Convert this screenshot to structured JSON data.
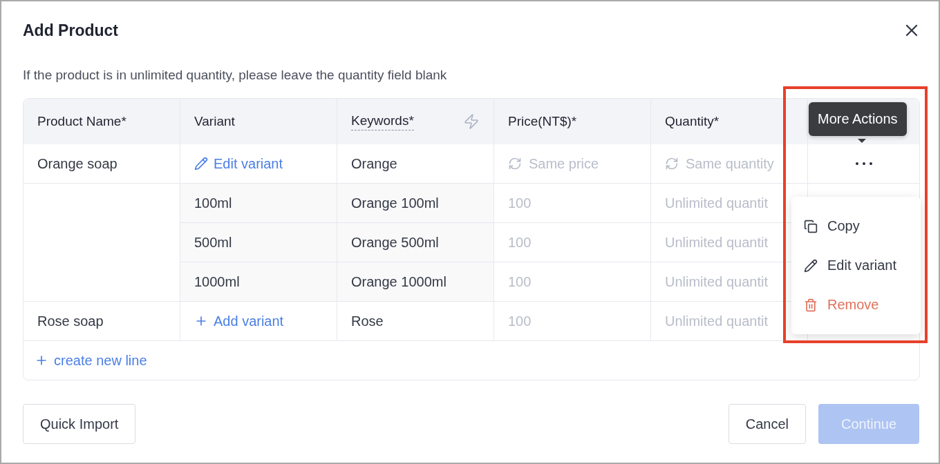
{
  "dialog": {
    "title": "Add Product",
    "notice": "If the product is in unlimited quantity, please leave the quantity field blank",
    "columns": [
      {
        "label": "Product Name*",
        "kind": "text"
      },
      {
        "label": "Variant",
        "kind": "text"
      },
      {
        "label": "Keywords*",
        "kind": "keywords"
      },
      {
        "label": "Price(NT$)*",
        "kind": "text"
      },
      {
        "label": "Quantity*",
        "kind": "text"
      }
    ],
    "products": [
      {
        "name": "Orange soap",
        "variant_action": {
          "kind": "edit",
          "label": "Edit variant"
        },
        "keywords": "Orange",
        "price": {
          "placeholder": "Same price",
          "kind": "sync-price"
        },
        "quantity": {
          "placeholder": "Same quantity",
          "kind": "sync-quantity"
        },
        "more_button": true,
        "variants": [
          {
            "name": "100ml",
            "keywords": "Orange 100ml",
            "price": {
              "placeholder": "100"
            },
            "quantity": {
              "placeholder": "Unlimited quantit"
            }
          },
          {
            "name": "500ml",
            "keywords": "Orange 500ml",
            "price": {
              "placeholder": "100"
            },
            "quantity": {
              "placeholder": "Unlimited quantit"
            }
          },
          {
            "name": "1000ml",
            "keywords": "Orange 1000ml",
            "price": {
              "placeholder": "100"
            },
            "quantity": {
              "placeholder": "Unlimited quantit"
            }
          }
        ]
      },
      {
        "name": "Rose soap",
        "variant_action": {
          "kind": "add",
          "label": "Add variant"
        },
        "keywords": "Rose",
        "price": {
          "placeholder": "100",
          "kind": "plain"
        },
        "quantity": {
          "placeholder": "Unlimited quantit",
          "kind": "plain"
        }
      }
    ],
    "create_line": "create new line",
    "tooltip": "More Actions",
    "menu": [
      {
        "kind": "copy",
        "label": "Copy"
      },
      {
        "kind": "edit",
        "label": "Edit variant"
      },
      {
        "kind": "remove",
        "label": "Remove"
      }
    ],
    "buttons": [
      {
        "label": "Quick Import",
        "kind": "secondary",
        "disabled": false
      },
      {
        "label": "Cancel",
        "kind": "secondary",
        "disabled": false
      },
      {
        "label": "Continue",
        "kind": "primary",
        "disabled": true
      }
    ]
  }
}
